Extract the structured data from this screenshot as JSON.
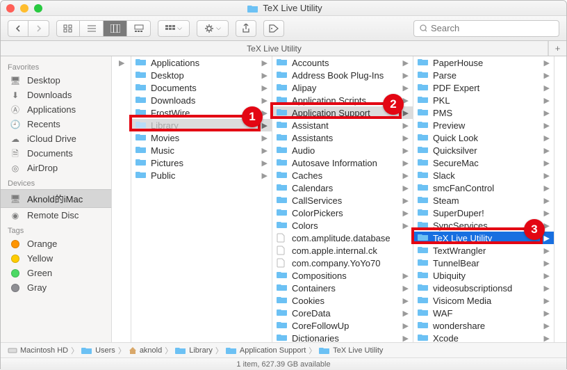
{
  "window": {
    "title": "TeX Live Utility"
  },
  "toolbar": {
    "search_placeholder": "Search"
  },
  "tab": {
    "title": "TeX Live Utility"
  },
  "sidebar": {
    "sections": [
      {
        "header": "Favorites",
        "items": [
          {
            "icon": "desktop",
            "label": "Desktop"
          },
          {
            "icon": "download",
            "label": "Downloads"
          },
          {
            "icon": "app",
            "label": "Applications"
          },
          {
            "icon": "clock",
            "label": "Recents"
          },
          {
            "icon": "cloud",
            "label": "iCloud Drive"
          },
          {
            "icon": "doc",
            "label": "Documents"
          },
          {
            "icon": "airdrop",
            "label": "AirDrop"
          }
        ]
      },
      {
        "header": "Devices",
        "items": [
          {
            "icon": "imac",
            "label": "Aknold的iMac",
            "selected": true
          },
          {
            "icon": "disc",
            "label": "Remote Disc"
          }
        ]
      },
      {
        "header": "Tags",
        "items": [
          {
            "icon": "tag",
            "color": "#ff9500",
            "label": "Orange"
          },
          {
            "icon": "tag",
            "color": "#ffcc00",
            "label": "Yellow"
          },
          {
            "icon": "tag",
            "color": "#4cd964",
            "label": "Green"
          },
          {
            "icon": "tag",
            "color": "#8e8e93",
            "label": "Gray"
          }
        ]
      }
    ]
  },
  "columns": [
    {
      "items": [
        {
          "name": "Applications",
          "folder": true
        },
        {
          "name": "Desktop",
          "folder": true
        },
        {
          "name": "Documents",
          "folder": true
        },
        {
          "name": "Downloads",
          "folder": true
        },
        {
          "name": "FrostWire",
          "folder": true
        },
        {
          "name": "Library",
          "folder": true,
          "path": true,
          "gray": true
        },
        {
          "name": "Movies",
          "folder": true
        },
        {
          "name": "Music",
          "folder": true
        },
        {
          "name": "Pictures",
          "folder": true
        },
        {
          "name": "Public",
          "folder": true
        }
      ]
    },
    {
      "items": [
        {
          "name": "Accounts",
          "folder": true
        },
        {
          "name": "Address Book Plug-Ins",
          "folder": true
        },
        {
          "name": "Alipay",
          "folder": true
        },
        {
          "name": "Application Scripts",
          "folder": true
        },
        {
          "name": "Application Support",
          "folder": true,
          "path": true
        },
        {
          "name": "Assistant",
          "folder": true
        },
        {
          "name": "Assistants",
          "folder": true
        },
        {
          "name": "Audio",
          "folder": true
        },
        {
          "name": "Autosave Information",
          "folder": true
        },
        {
          "name": "Caches",
          "folder": true
        },
        {
          "name": "Calendars",
          "folder": true
        },
        {
          "name": "CallServices",
          "folder": true
        },
        {
          "name": "ColorPickers",
          "folder": true
        },
        {
          "name": "Colors",
          "folder": true
        },
        {
          "name": "com.amplitude.database",
          "folder": false
        },
        {
          "name": "com.apple.internal.ck",
          "folder": false
        },
        {
          "name": "com.company.YoYo70",
          "folder": false
        },
        {
          "name": "Compositions",
          "folder": true
        },
        {
          "name": "Containers",
          "folder": true
        },
        {
          "name": "Cookies",
          "folder": true
        },
        {
          "name": "CoreData",
          "folder": true
        },
        {
          "name": "CoreFollowUp",
          "folder": true
        },
        {
          "name": "Dictionaries",
          "folder": true
        }
      ]
    },
    {
      "items": [
        {
          "name": "PaperHouse",
          "folder": true
        },
        {
          "name": "Parse",
          "folder": true
        },
        {
          "name": "PDF Expert",
          "folder": true
        },
        {
          "name": "PKL",
          "folder": true
        },
        {
          "name": "PMS",
          "folder": true
        },
        {
          "name": "Preview",
          "folder": true
        },
        {
          "name": "Quick Look",
          "folder": true
        },
        {
          "name": "Quicksilver",
          "folder": true
        },
        {
          "name": "SecureMac",
          "folder": true
        },
        {
          "name": "Slack",
          "folder": true
        },
        {
          "name": "smcFanControl",
          "folder": true
        },
        {
          "name": "Steam",
          "folder": true
        },
        {
          "name": "SuperDuper!",
          "folder": true
        },
        {
          "name": "SyncServices",
          "folder": true
        },
        {
          "name": "TeX Live Utility",
          "folder": true,
          "selected": true
        },
        {
          "name": "TextWrangler",
          "folder": true
        },
        {
          "name": "TunnelBear",
          "folder": true
        },
        {
          "name": "Ubiquity",
          "folder": true
        },
        {
          "name": "videosubscriptionsd",
          "folder": true
        },
        {
          "name": "Visicom Media",
          "folder": true
        },
        {
          "name": "WAF",
          "folder": true
        },
        {
          "name": "wondershare",
          "folder": true
        },
        {
          "name": "Xcode",
          "folder": true
        }
      ]
    }
  ],
  "annotations": [
    {
      "n": "1",
      "col": 0,
      "row": 5
    },
    {
      "n": "2",
      "col": 1,
      "row": 4
    },
    {
      "n": "3",
      "col": 2,
      "row": 14
    }
  ],
  "pathbar": [
    {
      "icon": "hd",
      "label": "Macintosh HD"
    },
    {
      "icon": "folder",
      "label": "Users"
    },
    {
      "icon": "home",
      "label": "aknold"
    },
    {
      "icon": "folder",
      "label": "Library"
    },
    {
      "icon": "folder",
      "label": "Application Support"
    },
    {
      "icon": "folder",
      "label": "TeX Live Utility"
    }
  ],
  "status": "1 item, 627.39 GB available"
}
